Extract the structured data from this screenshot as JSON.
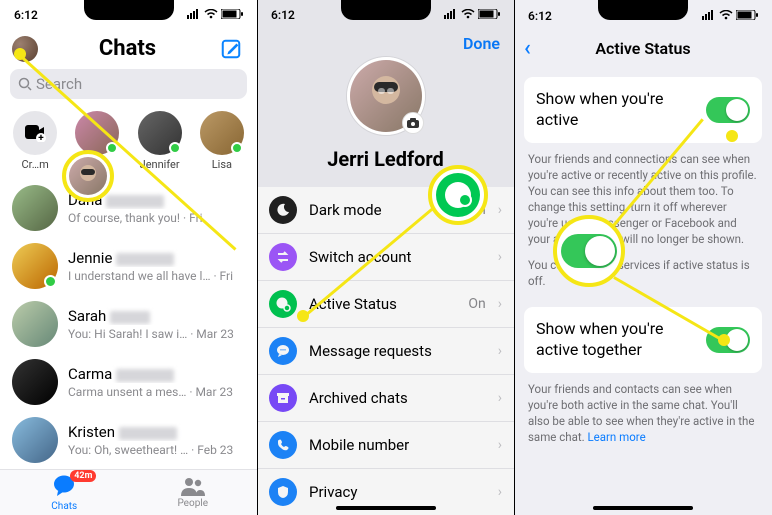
{
  "status": {
    "time": "6:12"
  },
  "p1": {
    "title": "Chats",
    "search_placeholder": "Search",
    "stories": [
      {
        "label": "Cr…m"
      },
      {
        "label": "…a"
      },
      {
        "label": "Jennifer"
      },
      {
        "label": "Lisa"
      }
    ],
    "chats": [
      {
        "name": "Dana",
        "sub": "Of course, thank you! · Fri"
      },
      {
        "name": "Jennie",
        "sub": "I understand we all have l… · Fri"
      },
      {
        "name": "Sarah",
        "sub": "You: Hi Sarah! I saw i… · Mar 23"
      },
      {
        "name": "Carma",
        "sub": "Carma unsent a mes… · Mar 23"
      },
      {
        "name": "Kristen",
        "sub": "You: Oh, sweetheart! … · Feb 23"
      }
    ],
    "tabs": {
      "chats": "Chats",
      "people": "People",
      "badge": "42m"
    }
  },
  "p2": {
    "done": "Done",
    "name": "Jerri Ledford",
    "rows": [
      {
        "icon": "dark-mode-icon",
        "label": "Dark mode",
        "value": "System",
        "color": "#222"
      },
      {
        "icon": "switch-account-icon",
        "label": "Switch account",
        "value": "",
        "color": "#a259ff"
      },
      {
        "icon": "active-status-icon",
        "label": "Active Status",
        "value": "On",
        "color": "#00c853"
      },
      {
        "icon": "message-requests-icon",
        "label": "Message requests",
        "value": "",
        "color": "#1e88ff"
      },
      {
        "icon": "archived-chats-icon",
        "label": "Archived chats",
        "value": "",
        "color": "#7c4dff"
      },
      {
        "icon": "mobile-number-icon",
        "label": "Mobile number",
        "value": "",
        "color": "#1e88ff"
      },
      {
        "icon": "privacy-icon",
        "label": "Privacy",
        "value": "",
        "color": "#1e88ff"
      }
    ]
  },
  "p3": {
    "title": "Active Status",
    "card1_title": "Show when you're active",
    "desc1": "Your friends and connections can see when you're active or recently active on this profile. You can see this info about them too. To change this setting, turn it off wherever you're using Messenger or Facebook and your active status will no longer be shown.",
    "desc1b": "You can't use our services if active status is off.",
    "card2_title": "Show when you're active together",
    "desc2_a": "Your friends and contacts can see when you're both active in the same chat. You'll also be able to see when they're active in the same chat. ",
    "desc2_link": "Learn more"
  }
}
